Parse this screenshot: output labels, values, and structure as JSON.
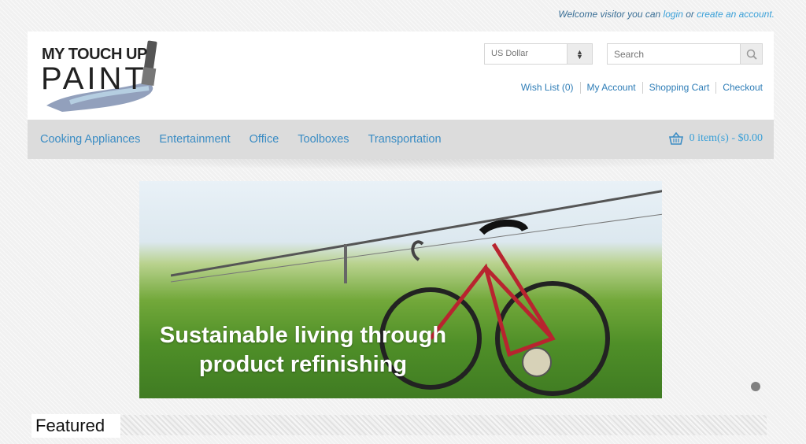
{
  "welcome": {
    "prefix": "Welcome visitor you can",
    "login": "login",
    "or": "or",
    "create": "create an account."
  },
  "logo": {
    "line1": "MY TOUCH UP",
    "line2": "PAINT"
  },
  "currency": {
    "selected": "US Dollar"
  },
  "search": {
    "placeholder": "Search"
  },
  "toplinks": [
    "Wish List (0)",
    "My Account",
    "Shopping Cart",
    "Checkout"
  ],
  "nav": [
    "Cooking Appliances",
    "Entertainment",
    "Office",
    "Toolboxes",
    "Transportation"
  ],
  "cart": {
    "label": "0 item(s) - $0.00",
    "icon": "basket-icon"
  },
  "banner": {
    "line1": "Sustainable living through",
    "line2": "product refinishing"
  },
  "featured": {
    "title": "Featured"
  },
  "colors": {
    "link": "#3a8cc4",
    "navbar": "#dcdcdc",
    "accent": "#3aa0d8"
  }
}
